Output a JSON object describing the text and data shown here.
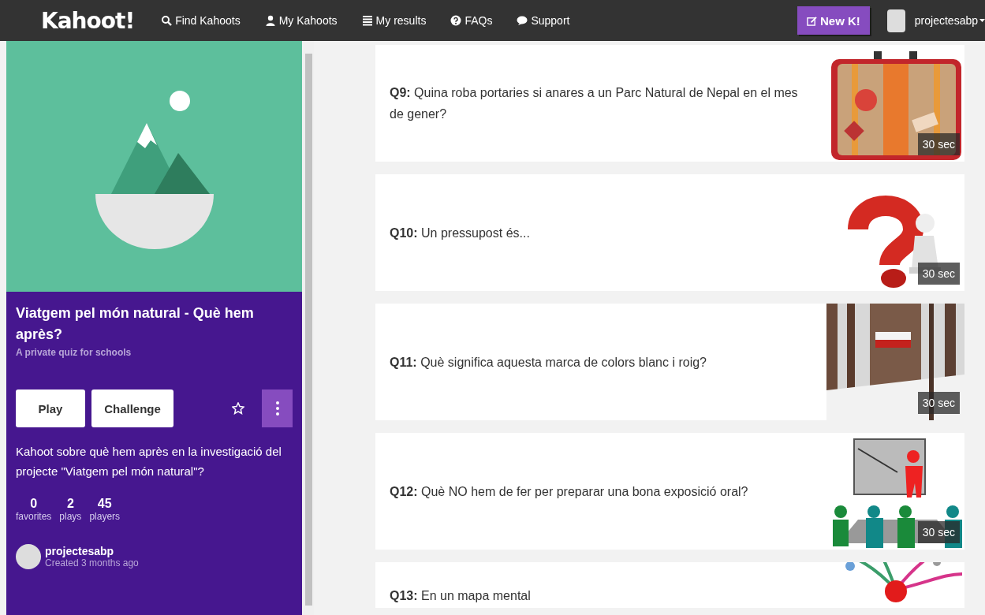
{
  "navbar": {
    "logo": "Kahoot!",
    "links": [
      {
        "label": "Find Kahoots"
      },
      {
        "label": "My Kahoots"
      },
      {
        "label": "My results"
      },
      {
        "label": "FAQs"
      },
      {
        "label": "Support"
      }
    ],
    "new_button": "New K!",
    "username": "projectesabp"
  },
  "kahoot": {
    "title": "Viatgem pel món natural - Què hem après?",
    "subtitle": "A private quiz for schools",
    "buttons": [
      "Play",
      "Challenge"
    ],
    "favorited": false,
    "description": "Kahoot sobre què hem après en la investigació del projecte \"Viatgem pel món natural\"?",
    "stats": [
      {
        "value": "0",
        "label": "favorites"
      },
      {
        "value": "2",
        "label": "plays"
      },
      {
        "value": "45",
        "label": "players"
      }
    ],
    "author": {
      "name": "projectesabp",
      "created": "Created 3 months ago"
    }
  },
  "questions": [
    {
      "text": "**Q9:** Quina roba portaries si anares a un Parc Natural de Nepal en el mes de gener?",
      "time": "30 sec"
    },
    {
      "text": "**Q10:** Un pressupost és...",
      "time": "30 sec"
    },
    {
      "text": "**Q11:** Què significa aquesta marca de colors blanc i roig?",
      "time": "30 sec"
    },
    {
      "text": "**Q12:** Què NO hem de fer per preparar una bona exposició oral?",
      "time": "30 sec"
    },
    {
      "text": "**Q13:** En un mapa mental"
    }
  ]
}
